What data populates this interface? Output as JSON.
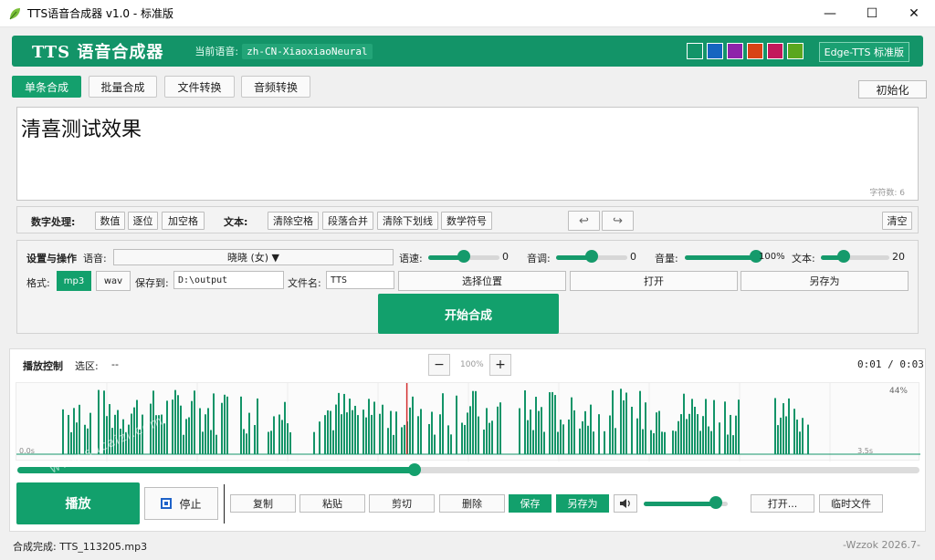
{
  "window": {
    "title": "TTS语音合成器 v1.0 - 标准版",
    "minimize": "—",
    "maximize": "☐",
    "close": "✕"
  },
  "banner": {
    "app_name": "TTS 语音合成器",
    "voice_label": "当前语音:",
    "voice_value": "zh-CN-XiaoxiaoNeural",
    "theme_colors": [
      "#139468",
      "#1565c0",
      "#8e24aa",
      "#d84315",
      "#c2185b",
      "#5aa71e"
    ],
    "edition": "Edge-TTS 标准版"
  },
  "tabs": [
    {
      "label": "单条合成",
      "active": true
    },
    {
      "label": "批量合成",
      "active": false
    },
    {
      "label": "文件转换",
      "active": false
    },
    {
      "label": "音频转换",
      "active": false
    }
  ],
  "init_button": "初始化",
  "editor": {
    "text": "清喜测试效果",
    "char_count": "字符数: 6"
  },
  "text_tools": {
    "number_label": "数字处理:",
    "number_buttons": [
      "数值",
      "逐位",
      "加空格"
    ],
    "text_label": "文本:",
    "text_buttons": [
      "清除空格",
      "段落合并",
      "清除下划线",
      "数学符号"
    ],
    "undo": "↩",
    "redo": "↪",
    "clear": "清空"
  },
  "settings": {
    "title": "设置与操作",
    "voice_label": "语音:",
    "voice_value": "晓晓 (女) ▼",
    "rate_label": "语速:",
    "rate_value": "0",
    "rate_level": 0.5,
    "pitch_label": "音调:",
    "pitch_value": "0",
    "pitch_level": 0.5,
    "volume_label": "音量:",
    "volume_value": "100%",
    "volume_level": 1.0,
    "textsize_label": "文本:",
    "textsize_value": "20",
    "textsize_level": 0.33,
    "format_label": "格式:",
    "format_mp3": "mp3",
    "format_wav": "wav",
    "save_to_label": "保存到:",
    "save_to_value": "D:\\output",
    "filename_label": "文件名:",
    "filename_value": "TTS",
    "choose_location": "选择位置",
    "open": "打开",
    "save_as": "另存为",
    "start": "开始合成"
  },
  "playback": {
    "title": "播放控制",
    "selection_label": "选区:",
    "selection_value": "--",
    "zoom_out": "−",
    "zoom_level": "100%",
    "zoom_in": "+",
    "time": "0:01 / 0:03",
    "wave_percent": "44%",
    "wave_start": "0.0s",
    "wave_end": "3.5s",
    "progress": 0.44,
    "play": "播放",
    "stop": "停止",
    "copy": "复制",
    "paste": "粘贴",
    "cut": "剪切",
    "delete": "删除",
    "save": "保存",
    "save_as": "另存为",
    "volume_icon": "speaker-icon",
    "volume_level": 0.86,
    "open": "打开...",
    "temp_files": "临时文件"
  },
  "status": {
    "left": "合成完成: TTS_113205.mp3",
    "right": "-Wzzok 2026.7-"
  },
  "watermark": "www.sucaizi.com"
}
